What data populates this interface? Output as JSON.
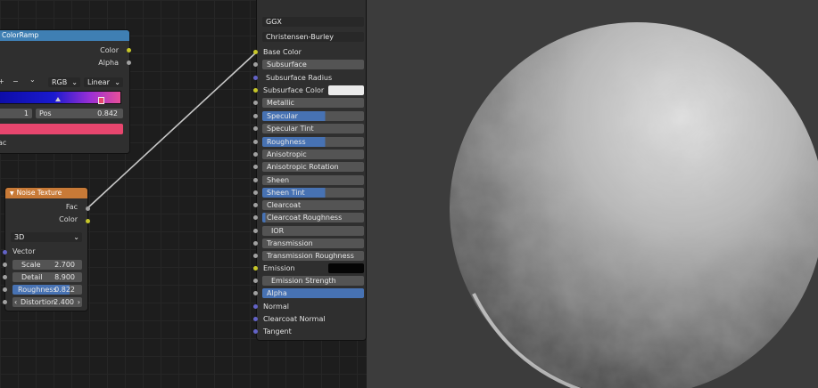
{
  "colorramp": {
    "title": "ColorRamp",
    "out_color": "Color",
    "out_alpha": "Alpha",
    "plus": "+",
    "minus": "−",
    "chev": "⌄",
    "mode": "RGB",
    "interp": "Linear",
    "index": "1",
    "pos_label": "Pos",
    "pos_value": "0.842",
    "in_fac": "ac"
  },
  "noise": {
    "title": "Noise Texture",
    "out_fac": "Fac",
    "out_color": "Color",
    "dims": "3D",
    "vector": "Vector",
    "fields": [
      {
        "label": "Scale",
        "value": "2.700"
      },
      {
        "label": "Detail",
        "value": "8.900"
      },
      {
        "label": "Roughness",
        "value": "0.822"
      },
      {
        "label": "Distortion",
        "value": "2.400"
      }
    ]
  },
  "bsdf": {
    "distribution": "GGX",
    "subsurface_method": "Christensen-Burley",
    "base_color": "Base Color",
    "subsurface": "Subsurface",
    "subsurface_radius": "Subsurface Radius",
    "subsurface_color": "Subsurface Color",
    "metallic": "Metallic",
    "specular": "Specular",
    "specular_tint": "Specular Tint",
    "roughness": "Roughness",
    "anisotropic": "Anisotropic",
    "anisotropic_rotation": "Anisotropic Rotation",
    "sheen": "Sheen",
    "sheen_tint": "Sheen Tint",
    "clearcoat": "Clearcoat",
    "clearcoat_roughness": "Clearcoat Roughness",
    "ior": "IOR",
    "transmission": "Transmission",
    "transmission_roughness": "Transmission Roughness",
    "emission": "Emission",
    "emission_strength": "Emission Strength",
    "alpha": "Alpha",
    "normal": "Normal",
    "clearcoat_normal": "Clearcoat Normal",
    "tangent": "Tangent"
  },
  "colors": {
    "colorramp_header": "#3f7fb3",
    "noise_header": "#c87a37",
    "socket_color": "#c7c729",
    "socket_float": "#a1a1a1",
    "socket_vector": "#6363c7",
    "field_active": "#4772b3",
    "ramp_stop_color": "#e8466e"
  }
}
